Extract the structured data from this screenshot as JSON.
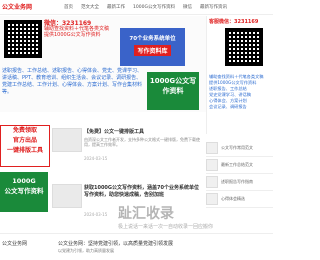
{
  "header": {
    "logo": "公文业务网",
    "nav": [
      "首页",
      "范文大全",
      "最新工作",
      "1000G公文写作资料",
      "微信",
      "最新写作资讯"
    ]
  },
  "ads": {
    "left_contact": {
      "wechat_label": "微信：3231169",
      "line2": "辅助查找资料＋代笔各类文稿",
      "line3": "提供1000G公文写作资料"
    },
    "left_categories": "述职报告、工作总结、述职报告、心得体会、党史、党课学习、讲话稿、PPT、教育培训、组织生活会、会议记录、调研报告、党建工作总结、工作计划、心得体会、方案计划、写作合集材料等。",
    "blue_box": {
      "top": "70个业务系统单位",
      "cta": "写作资料库"
    },
    "green_box": {
      "text": "1000G公文写作资料"
    },
    "right": {
      "title": "客服微信：3231169",
      "lines": [
        "辅助查找资料＋代笔各类文稿",
        "提供1000G公文写作资料",
        "述职报告、工作总结",
        "党史党课学习、讲话稿",
        "心得体会、方案计划",
        "会议记录、调研报告"
      ]
    },
    "red_ad": "免费领取\n官方出品\n一键排版工具",
    "green_ad2": "1000G\n公文写作资料"
  },
  "articles": [
    {
      "title": "【免费】公文一键排版工具",
      "desc": "由资深公文工作者开发，支持多种公文格式一键排版，免费下载使用，提高工作效率。",
      "date": "2024-03-15"
    },
    {
      "title": "获取1000G公文写作资料，涵盖70个业务系统单位写作资料，助您快速成稿，告别加班",
      "desc": "",
      "date": "2024-03-15"
    }
  ],
  "right_list": [
    "公文写作常用范文",
    "最新工作总结范文",
    "述职报告写作指南",
    "心得体会精选"
  ],
  "watermark": {
    "main": "趾汇收录",
    "sub": "极上说话一来话一次一自动收录一回应搬你"
  },
  "bottom": {
    "site": "公文业务网",
    "headline": "公文业务网：坚持党建引领，以高质量党建引领发展",
    "sub": "以党建为引领，助力高质量发展"
  }
}
